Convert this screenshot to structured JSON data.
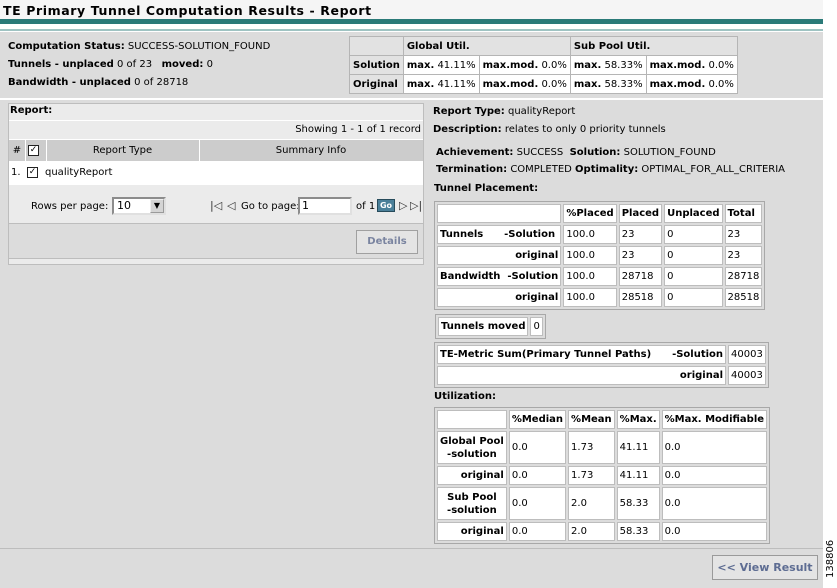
{
  "title": "TE Primary Tunnel Computation Results - Report",
  "summary": {
    "status_label": "Computation Status:",
    "status_value": "SUCCESS-SOLUTION_FOUND",
    "tunnels_label": "Tunnels - unplaced",
    "tunnels_value": "0 of 23",
    "moved_label": "moved:",
    "moved_value": "0",
    "bandwidth_label": "Bandwidth - unplaced",
    "bandwidth_value": "0 of 28718"
  },
  "util_table": {
    "global_header": "Global Util.",
    "subpool_header": "Sub Pool Util.",
    "rows": [
      {
        "label": "Solution",
        "g_max_label": "max.",
        "g_max": "41.11%",
        "g_mod_label": "max.mod.",
        "g_mod": "0.0%",
        "s_max_label": "max.",
        "s_max": "58.33%",
        "s_mod_label": "max.mod.",
        "s_mod": "0.0%"
      },
      {
        "label": "Original",
        "g_max_label": "max.",
        "g_max": "41.11%",
        "g_mod_label": "max.mod.",
        "g_mod": "0.0%",
        "s_max_label": "max.",
        "s_max": "58.33%",
        "s_mod_label": "max.mod.",
        "s_mod": "0.0%"
      }
    ]
  },
  "report_panel": {
    "label": "Report:",
    "showing": "Showing 1 - 1 of 1 record",
    "columns": [
      "#",
      "Report Type",
      "Summary Info"
    ],
    "row": {
      "index": "1.",
      "type": "qualityReport",
      "summary": ""
    },
    "check_glyph": "✓",
    "rows_per_page_label": "Rows per page:",
    "rows_per_page_value": "10",
    "goto_label": "Go to page:",
    "page_value": "1",
    "page_of": "of 1",
    "go_button": "Go",
    "details_button": "Details"
  },
  "report": {
    "type_label": "Report Type:",
    "type_value": "qualityReport",
    "desc_label": "Description:",
    "desc_value": "relates to only 0 priority tunnels",
    "achievement_label": "Achievement:",
    "achievement_value": "SUCCESS",
    "solution_label": "Solution:",
    "solution_value": "SOLUTION_FOUND",
    "termination_label": "Termination:",
    "termination_value": "COMPLETED",
    "optimality_label": "Optimality:",
    "optimality_value": "OPTIMAL_FOR_ALL_CRITERIA",
    "placement_title": "Tunnel Placement:",
    "placement_headers": [
      "%Placed",
      "Placed",
      "Unplaced",
      "Total"
    ],
    "placement_rows": [
      {
        "label": "Tunnels      -Solution",
        "values": [
          "100.0",
          "23",
          "0",
          "23"
        ]
      },
      {
        "label": "original",
        "values": [
          "100.0",
          "23",
          "0",
          "23"
        ]
      },
      {
        "label": "Bandwidth  -Solution",
        "values": [
          "100.0",
          "28718",
          "0",
          "28718"
        ]
      },
      {
        "label": "original",
        "values": [
          "100.0",
          "28518",
          "0",
          "28518"
        ]
      }
    ],
    "moved_label": "Tunnels moved",
    "moved_value": "0",
    "metric_rows": [
      {
        "label": "TE-Metric Sum(Primary Tunnel Paths)      -Solution",
        "value": "40003"
      },
      {
        "label": "original",
        "value": "40003"
      }
    ],
    "utilization_title": "Utilization:",
    "utilization_headers": [
      "%Median",
      "%Mean",
      "%Max.",
      "%Max. Modifiable"
    ],
    "utilization_rows": [
      {
        "label1": "Global Pool",
        "label2": "-solution",
        "values": [
          "0.0",
          "1.73",
          "41.11",
          "0.0"
        ]
      },
      {
        "label1": "original",
        "label2": "",
        "values": [
          "0.0",
          "1.73",
          "41.11",
          "0.0"
        ]
      },
      {
        "label1": "Sub Pool",
        "label2": "-solution",
        "values": [
          "0.0",
          "2.0",
          "58.33",
          "0.0"
        ]
      },
      {
        "label1": "original",
        "label2": "",
        "values": [
          "0.0",
          "2.0",
          "58.33",
          "0.0"
        ]
      }
    ]
  },
  "footer": {
    "view_result_button": "<< View Result"
  },
  "side_code": "138806",
  "nav_glyphs": {
    "first": "|◁",
    "prev": "◁",
    "next": "▷",
    "last": "▷|",
    "dropdown": "▼"
  },
  "colors": {
    "title_rule": "#2a7a78",
    "panel_bg": "#dcdcdc",
    "go_button": "#4a7f99"
  }
}
